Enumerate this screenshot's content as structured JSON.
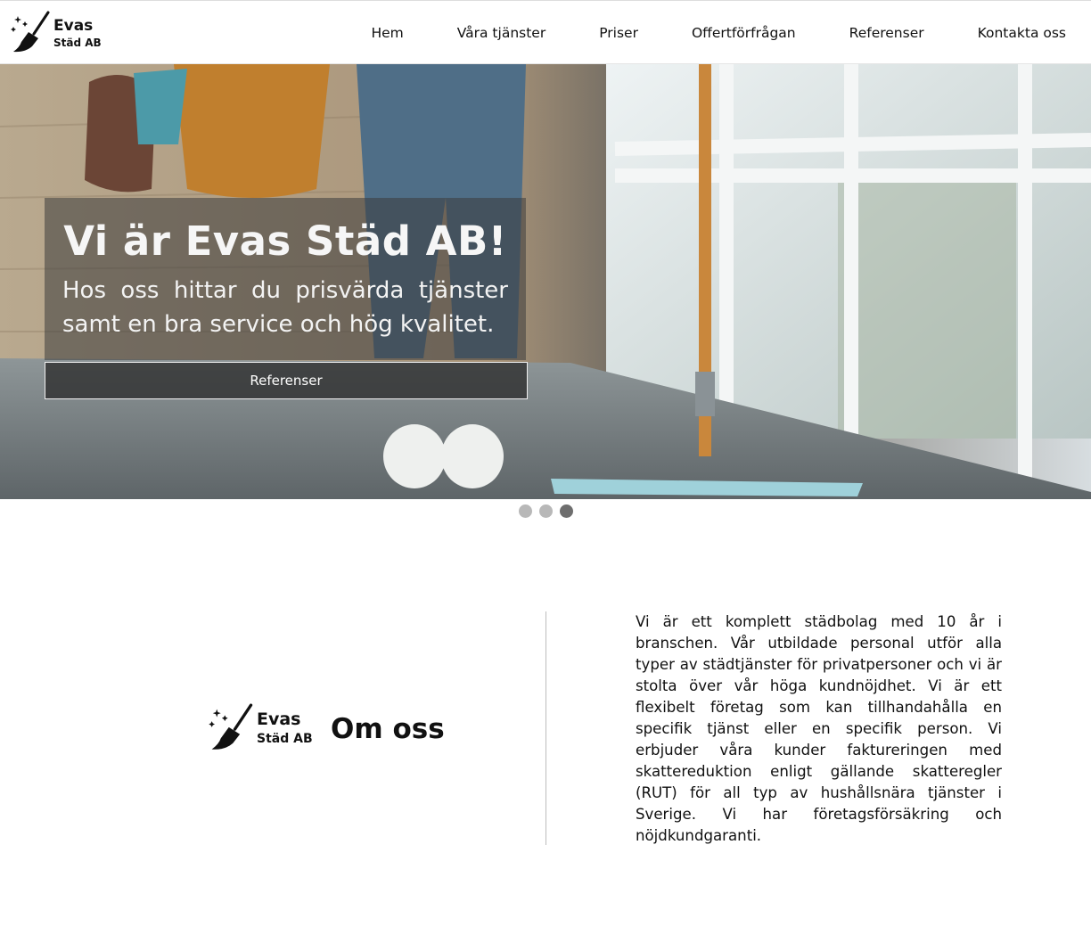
{
  "header": {
    "logo": {
      "name": "Evas",
      "sub": "Städ AB"
    },
    "nav": [
      "Hem",
      "Våra tjänster",
      "Priser",
      "Offertförfrågan",
      "Referenser",
      "Kontakta oss"
    ]
  },
  "hero": {
    "title": "Vi är Evas Städ AB!",
    "subtitle": "Hos oss hittar du prisvärda tjänster samt en bra service och hög kvalitet.",
    "button_label": "Referenser",
    "slides_total": 3,
    "active_slide": 3
  },
  "about": {
    "logo": {
      "name": "Evas",
      "sub": "Städ AB"
    },
    "heading": "Om oss",
    "text": "Vi är ett komplett städbolag med 10 år i branschen. Vår utbildade personal utför alla typer av städtjänster för privatpersoner och vi är stolta över vår höga kundnöjdhet. Vi är ett flexibelt företag som kan tillhandahålla en specifik tjänst eller en specifik person. Vi erbjuder våra kunder faktureringen med skattereduktion enligt gällande skatteregler (RUT) för all typ av hushållsnära tjänster i Sverige. Vi har företagsförsäkring och nöjdkundgaranti."
  },
  "colors": {
    "dot_inactive": "#b8b8b8",
    "dot_active": "#6e6e6e",
    "divider": "#bdbdbd"
  }
}
